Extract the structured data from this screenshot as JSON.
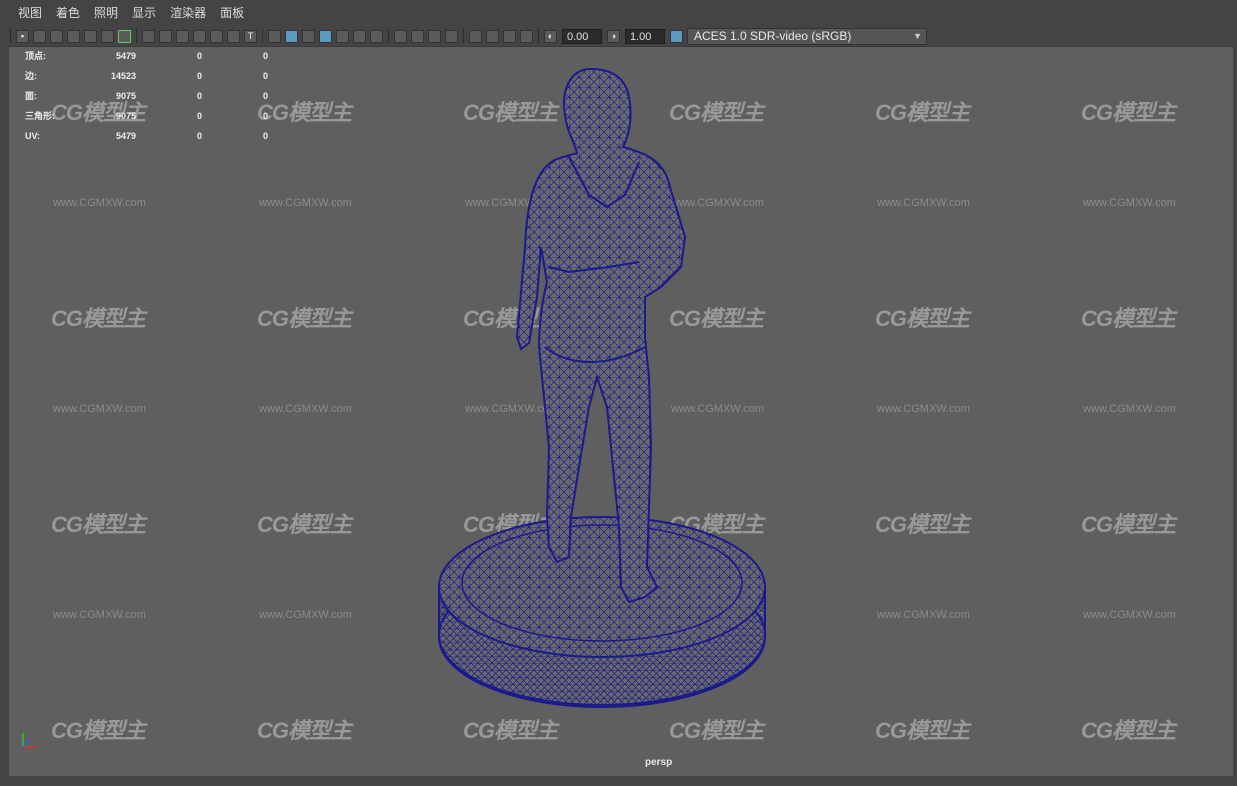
{
  "menu": [
    "视图",
    "着色",
    "照明",
    "显示",
    "渲染器",
    "面板"
  ],
  "toolbar": {
    "exposure": "0.00",
    "gamma": "1.00",
    "color_space": "ACES 1.0 SDR-video (sRGB)"
  },
  "hud": {
    "rows": [
      {
        "label": "顶点:",
        "v1": "5479",
        "v2": "0",
        "v3": "0"
      },
      {
        "label": "边:",
        "v1": "14523",
        "v2": "0",
        "v3": "0"
      },
      {
        "label": "面:",
        "v1": "9075",
        "v2": "0",
        "v3": "0"
      },
      {
        "label": "三角形:",
        "v1": "9075",
        "v2": "0",
        "v3": "0"
      },
      {
        "label": "UV:",
        "v1": "5479",
        "v2": "0",
        "v3": "0"
      }
    ]
  },
  "camera_label": "persp",
  "watermark": {
    "logo": "CG模型主",
    "url": "www.CGMXW.com"
  },
  "colors": {
    "wire": "#1a1a8c",
    "viewport_bg": "#5f5f5f",
    "accent": "#5a9ac0"
  }
}
